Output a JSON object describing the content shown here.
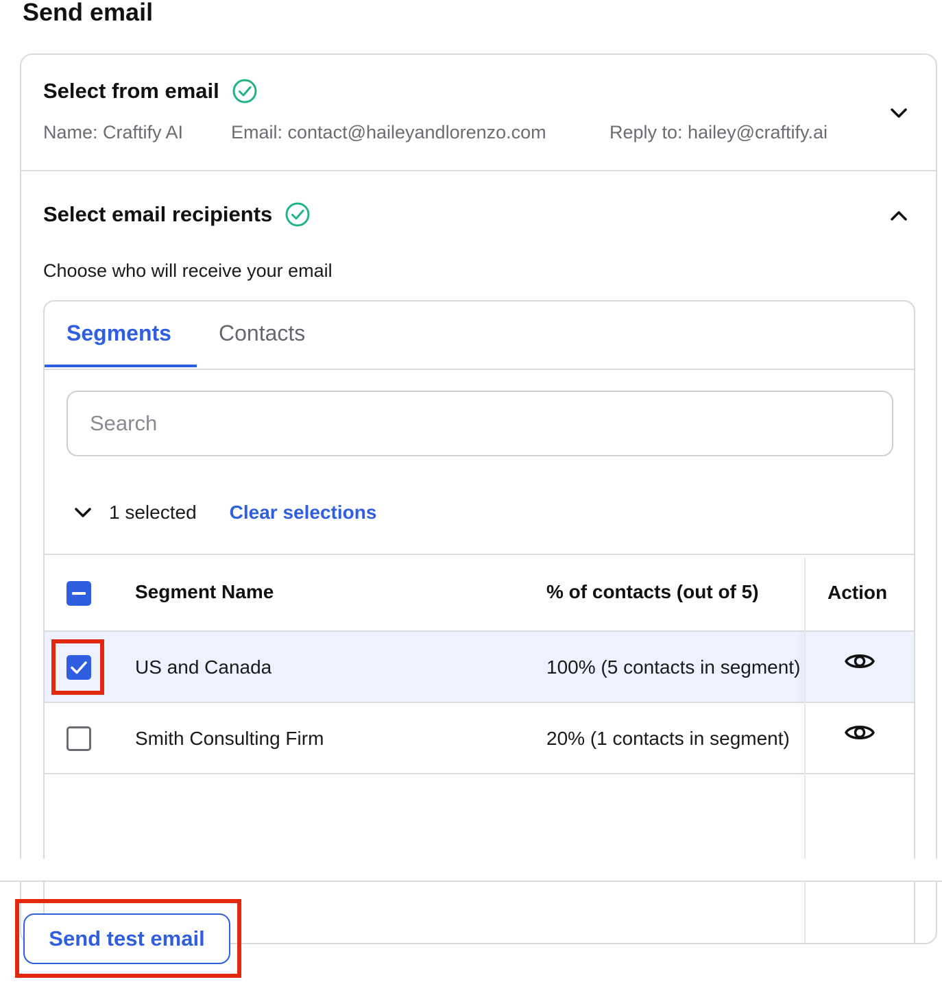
{
  "page_title": "Send email",
  "from_section": {
    "title": "Select from email",
    "name": "Name: Craftify AI",
    "email": "Email: contact@haileyandlorenzo.com",
    "reply_to": "Reply to: hailey@craftify.ai"
  },
  "recipients_section": {
    "title": "Select email recipients",
    "subtitle": "Choose who will receive your email",
    "tabs": [
      {
        "label": "Segments",
        "active": true
      },
      {
        "label": "Contacts",
        "active": false
      }
    ],
    "search_placeholder": "Search",
    "selected_count": "1 selected",
    "clear_label": "Clear selections",
    "table": {
      "headers": {
        "name": "Segment Name",
        "percent": "% of contacts (out of 5)",
        "action": "Action"
      },
      "rows": [
        {
          "name": "US and Canada",
          "percent": "100% (5 contacts in segment)",
          "checked": true
        },
        {
          "name": "Smith Consulting Firm",
          "percent": "20% (1 contacts in segment)",
          "checked": false
        }
      ]
    }
  },
  "footer": {
    "send_test_label": "Send test email"
  },
  "colors": {
    "accent": "#2f5fe0",
    "success": "#1fb57e",
    "highlight": "#e32810"
  },
  "icons": [
    "check-circle-icon",
    "chevron-down-icon",
    "chevron-up-icon",
    "checkbox-indeterminate-icon",
    "checkbox-checked-icon",
    "checkbox-empty-icon",
    "eye-icon"
  ]
}
